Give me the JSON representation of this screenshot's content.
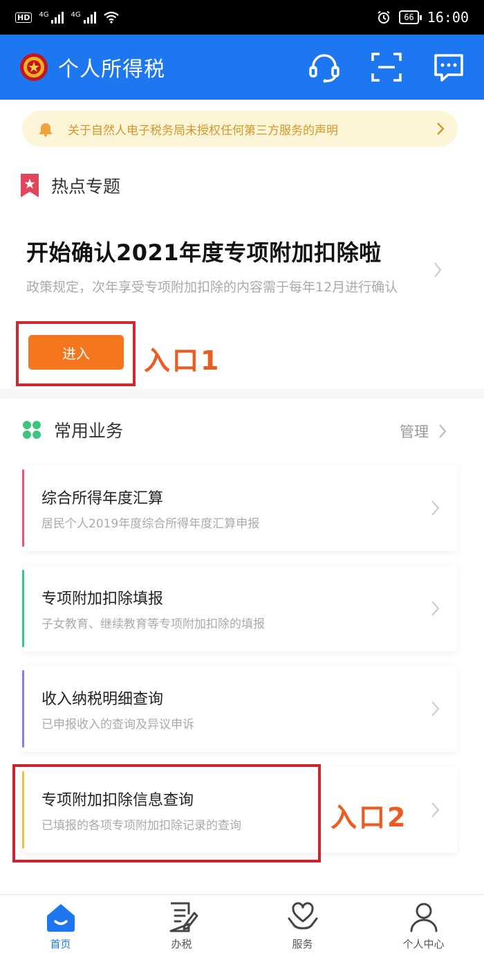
{
  "status_bar": {
    "hd": "HD",
    "sim1": "4G",
    "sim2": "4G",
    "battery": "66",
    "time": "16:00"
  },
  "header": {
    "title": "个人所得税",
    "icons": [
      "emblem-icon",
      "headset-icon",
      "scan-icon",
      "message-icon"
    ],
    "color": "#1d77f0"
  },
  "notice": {
    "text": "关于自然人电子税务局未授权任何第三方服务的声明"
  },
  "hot_topics": {
    "title": "热点专题",
    "card_title": "开始确认2021年度专项附加扣除啦",
    "card_desc": "政策规定，次年享受专项附加扣除的内容需于每年12月进行确认",
    "enter_label": "进入",
    "annotation": "入口1"
  },
  "common_services": {
    "title": "常用业务",
    "manage_label": "管理",
    "items": [
      {
        "name": "综合所得年度汇算",
        "desc": "居民个人2019年度综合所得年度汇算申报",
        "accent": "#e2587a"
      },
      {
        "name": "专项附加扣除填报",
        "desc": "子女教育、继续教育等专项附加扣除的填报",
        "accent": "#35c58a"
      },
      {
        "name": "收入纳税明细查询",
        "desc": "已申报收入的查询及异议申诉",
        "accent": "#8a7fe0"
      },
      {
        "name": "专项附加扣除信息查询",
        "desc": "已填报的各项专项附加扣除记录的查询",
        "accent": "#e8c34a"
      }
    ],
    "annotation": "入口2"
  },
  "tabs": [
    {
      "label": "首页",
      "icon": "home-icon",
      "active": true
    },
    {
      "label": "办税",
      "icon": "tax-form-icon",
      "active": false
    },
    {
      "label": "服务",
      "icon": "service-heart-icon",
      "active": false
    },
    {
      "label": "个人中心",
      "icon": "person-icon",
      "active": false
    }
  ],
  "colors": {
    "accent": "#1d77f0",
    "enter_button": "#f6761d",
    "annotation_text": "#ec5b1f",
    "annotation_box": "#d0282e"
  }
}
